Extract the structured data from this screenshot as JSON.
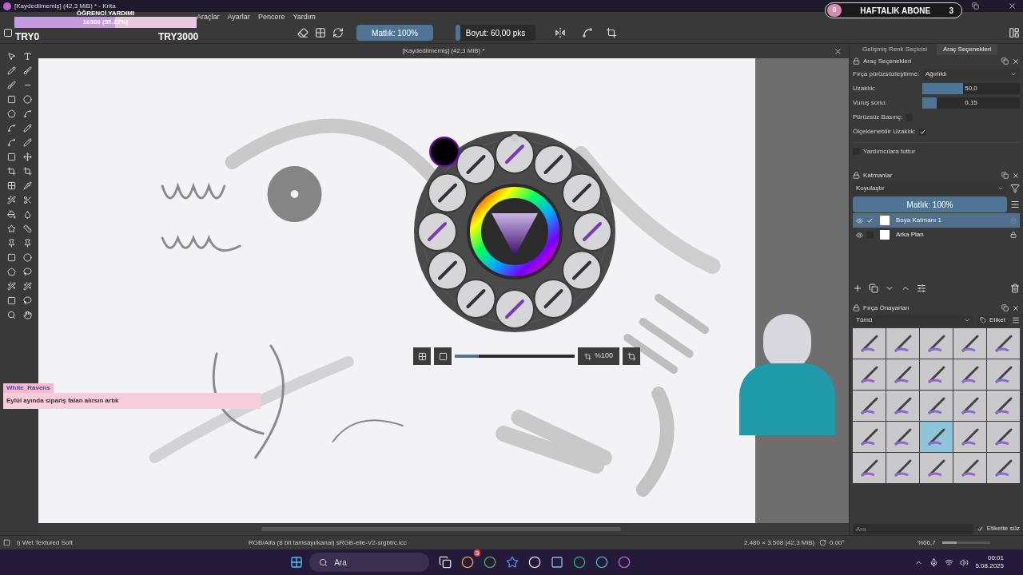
{
  "window": {
    "title": "[Kaydedilmemiş]  (42,3 MiB) * - Krita"
  },
  "menu": [
    "Araçlar",
    "Ayarlar",
    "Pencere",
    "Yardım"
  ],
  "toolbar": {
    "opacity": {
      "label": "Matlık: 100%",
      "level": 1
    },
    "size": {
      "label": "Boyut: 60,00 pks",
      "level": 0.06
    }
  },
  "document": {
    "title": "[Kaydedilmemiş]  (42,3 MiB) *"
  },
  "popup_palette": {
    "zoom": "%100",
    "level": 0.2
  },
  "right_tabs": [
    {
      "label": "Gelişmiş Renk Seçicisi",
      "selected": false
    },
    {
      "label": "Araç Seçenekleri",
      "selected": true
    }
  ],
  "tool_options": {
    "title": "Araç Seçenekleri",
    "rows": [
      {
        "kind": "select",
        "label": "Fırça pürüzsüzleştirme:",
        "value": "Ağırlıklı"
      },
      {
        "kind": "slider",
        "label": "Uzaklık:",
        "value": "50,0",
        "level": 0.42
      },
      {
        "kind": "slider",
        "label": "Vuruş sonu:",
        "value": "0,15",
        "level": 0.15
      },
      {
        "kind": "checkbox",
        "label": "Pürüzsüz Basınç:",
        "checked": false
      },
      {
        "kind": "checkbox",
        "label": "Ölçeklenebilir Uzaklık:",
        "checked": true
      },
      {
        "kind": "check_left",
        "label": "Yardımcılara tuttur",
        "checked": false
      }
    ]
  },
  "layers": {
    "title": "Katmanlar",
    "blend": "Koyulaştır",
    "opacity": {
      "label": "Matlık: 100%",
      "level": 1
    },
    "items": [
      {
        "name": "Boya Katmanı 1",
        "selected": true,
        "checked": true,
        "locked": false
      },
      {
        "name": "Arka Plan",
        "selected": false,
        "checked": false,
        "locked": true
      }
    ]
  },
  "presets": {
    "title": "Fırça Önayarları",
    "filter": "Tümü",
    "tag": "Etiket",
    "search_placeholder": "Ara",
    "tag_filter": {
      "label": "Etikette süz",
      "checked": true
    },
    "tiles": [
      {
        "selected": false
      },
      {
        "selected": false
      },
      {
        "selected": false
      },
      {
        "selected": false
      },
      {
        "selected": false
      },
      {
        "selected": false
      },
      {
        "selected": false
      },
      {
        "selected": false
      },
      {
        "selected": false
      },
      {
        "selected": false
      },
      {
        "selected": false
      },
      {
        "selected": false
      },
      {
        "selected": false
      },
      {
        "selected": false
      },
      {
        "selected": false
      },
      {
        "selected": false
      },
      {
        "selected": false
      },
      {
        "selected": true
      },
      {
        "selected": false
      },
      {
        "selected": false
      },
      {
        "selected": false
      },
      {
        "selected": false
      },
      {
        "selected": false
      },
      {
        "selected": false
      },
      {
        "selected": false
      }
    ]
  },
  "status_bar": {
    "tool": "i) Wet Textured Soft",
    "color_profile": "RGB/Alfa (8 bit tamsayı/kanal) sRGB-elle-V2-srgbtrc.icc",
    "image_size": "2.480 × 3.508 (42,3 MiB)",
    "rotation": "0,00°",
    "zoom": {
      "label": "%66,7",
      "level": 0.3
    }
  },
  "taskbar": {
    "search_placeholder": "Ara",
    "badge": "3",
    "time": "00:01",
    "date": "5.08.2025"
  },
  "stream_overlay": {
    "help": {
      "title": "ÖĞRENCİ YARDIMI",
      "progress": "16586 (55.27%)",
      "level": 0.5527
    },
    "counters": [
      "TRY0",
      "TRY3000"
    ],
    "goal": {
      "current": "0",
      "label": "HAFTALIK ABONE",
      "target": "3"
    },
    "chat": {
      "user": "White_Ravens",
      "message": "Eylül ayında sipariş falan alırsın artık"
    }
  }
}
